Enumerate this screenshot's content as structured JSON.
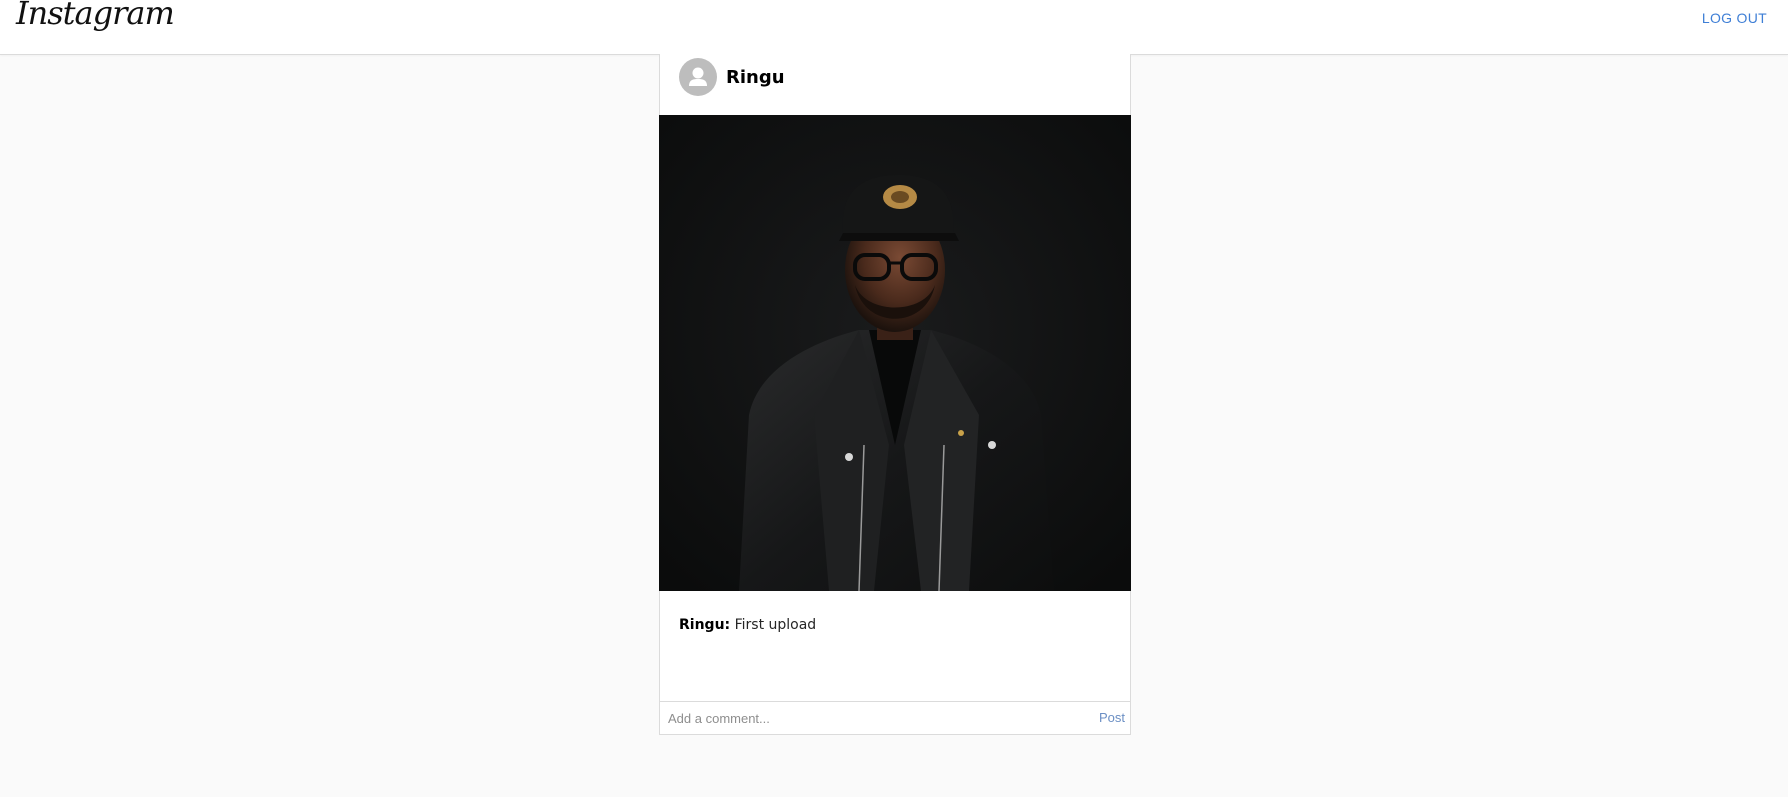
{
  "header": {
    "logo_text": "Instagram",
    "logout_label": "LOG OUT"
  },
  "post": {
    "username": "Ringu",
    "caption_user": "Ringu:",
    "caption_text": "First upload",
    "comment_placeholder": "Add a comment...",
    "post_button_label": "Post"
  },
  "colors": {
    "link_blue": "#3f7fd6",
    "post_blue": "#6b8fc4",
    "background": "#fafafa"
  },
  "icons": {
    "avatar": "user-avatar-icon"
  }
}
